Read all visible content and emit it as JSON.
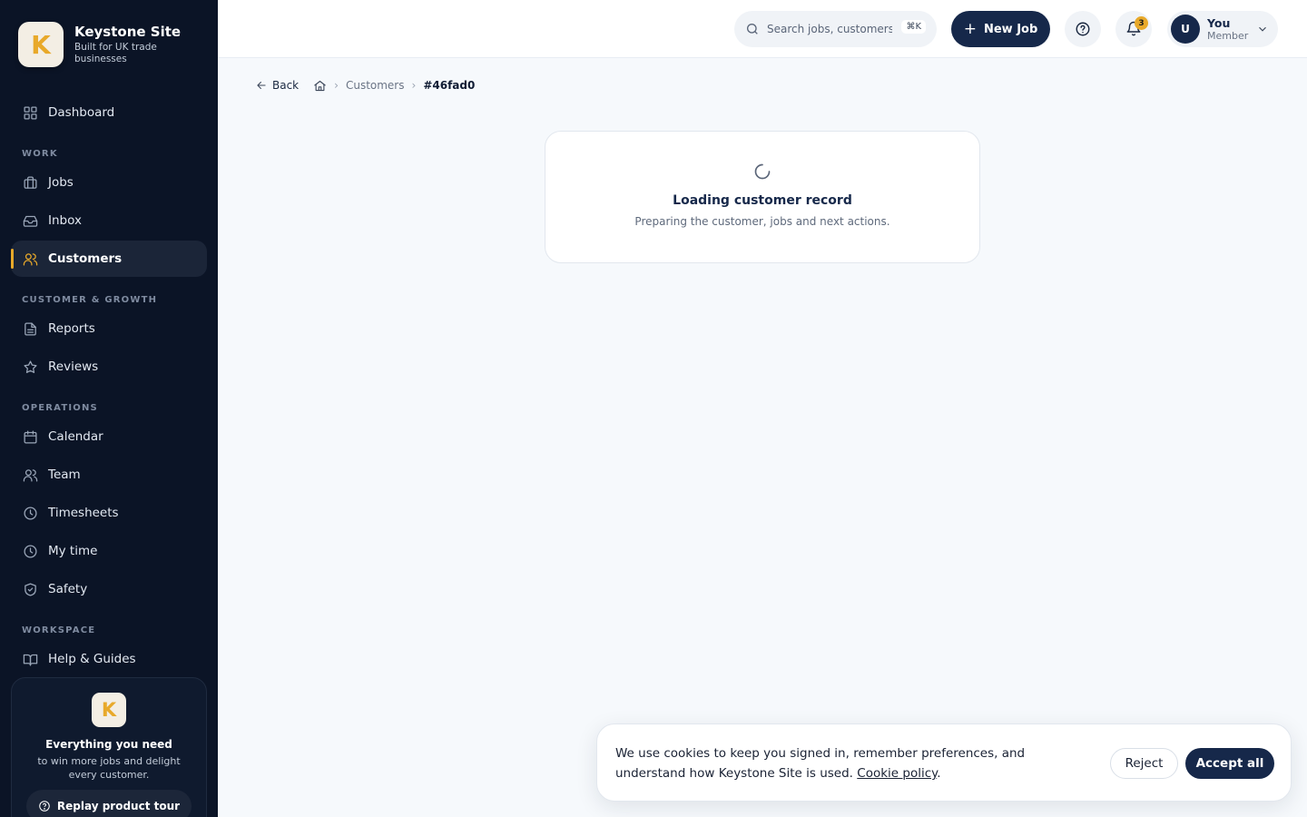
{
  "brand": {
    "name": "Keystone Site",
    "tagline": "Built for UK trade businesses",
    "logo_letter": "K",
    "accent": "#e8a92a"
  },
  "sidebar": {
    "dashboard": "Dashboard",
    "sections": {
      "work": "WORK",
      "growth": "CUSTOMER & GROWTH",
      "operations": "OPERATIONS",
      "workspace": "WORKSPACE"
    },
    "items": {
      "jobs": "Jobs",
      "inbox": "Inbox",
      "customers": "Customers",
      "reports": "Reports",
      "reviews": "Reviews",
      "calendar": "Calendar",
      "team": "Team",
      "timesheets": "Timesheets",
      "my_time": "My time",
      "safety": "Safety",
      "help": "Help & Guides"
    },
    "active": "customers",
    "promo": {
      "title": "Everything you need",
      "subtitle": "to win more jobs and delight every customer.",
      "button": "Replay product tour"
    }
  },
  "topbar": {
    "search_placeholder": "Search jobs, customers...",
    "shortcut": "⌘K",
    "new_job": "New Job",
    "notification_count": "3",
    "user": {
      "initial": "U",
      "name": "You",
      "role": "Member"
    }
  },
  "breadcrumb": {
    "back": "Back",
    "parent": "Customers",
    "current": "#46fad0"
  },
  "loading": {
    "title": "Loading customer record",
    "subtitle": "Preparing the customer, jobs and next actions."
  },
  "cookie": {
    "text": "We use cookies to keep you signed in, remember preferences, and understand how Keystone Site is used.",
    "link": "Cookie policy",
    "reject": "Reject",
    "accept": "Accept all"
  }
}
